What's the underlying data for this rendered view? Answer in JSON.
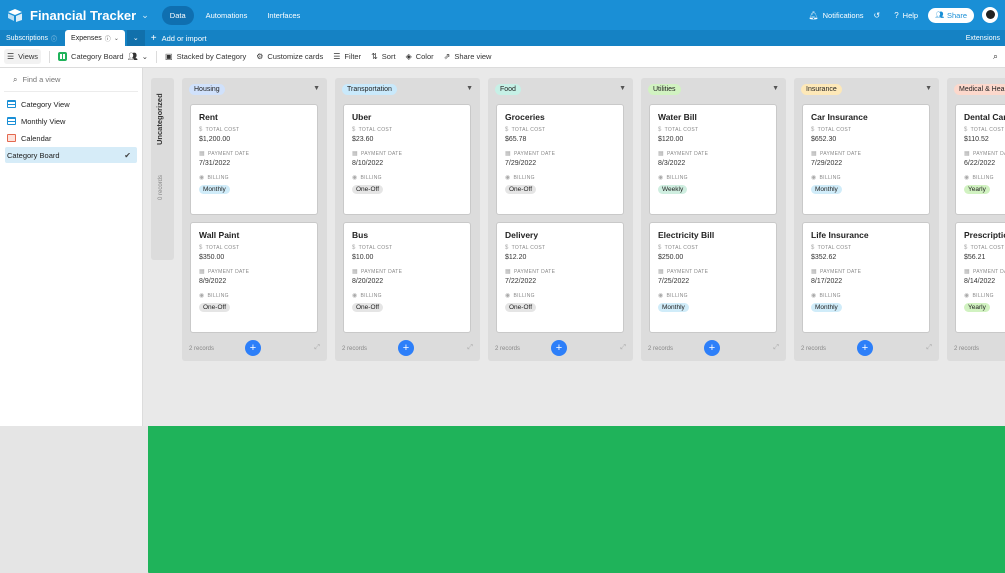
{
  "app": {
    "title": "Financial Tracker",
    "nav": [
      {
        "label": "Data",
        "active": true
      },
      {
        "label": "Automations",
        "active": false
      },
      {
        "label": "Interfaces",
        "active": false
      }
    ],
    "notifications": "Notifications",
    "help": "Help",
    "share": "Share"
  },
  "tabs": {
    "items": [
      {
        "label": "Subscriptions",
        "active": false
      },
      {
        "label": "Expenses",
        "active": true
      }
    ],
    "add_import": "Add or import",
    "extensions": "Extensions"
  },
  "toolbar": {
    "views": "Views",
    "view_name": "Category Board",
    "stacked": "Stacked by Category",
    "customize": "Customize cards",
    "filter": "Filter",
    "sort": "Sort",
    "color": "Color",
    "share_view": "Share view"
  },
  "sidebar": {
    "find_placeholder": "Find a view",
    "views": [
      {
        "label": "Category View",
        "icon": "grid-view-icon",
        "active": false
      },
      {
        "label": "Monthly View",
        "icon": "grid-view-icon",
        "active": false
      },
      {
        "label": "Calendar",
        "icon": "calendar-view-icon",
        "active": false
      },
      {
        "label": "Category Board",
        "icon": "kanban-view-icon",
        "active": true
      }
    ]
  },
  "board": {
    "uncategorized": {
      "label": "Uncategorized",
      "count": "0 records"
    },
    "field_labels": {
      "cost": "TOTAL COST",
      "date": "PAYMENT DATE",
      "billing": "BILLING"
    },
    "columns": [
      {
        "name": "Housing",
        "color": "#d0e1fb",
        "records": "2 records",
        "cards": [
          {
            "title": "Rent",
            "cost": "$1,200.00",
            "date": "7/31/2022",
            "billing": "Monthly"
          },
          {
            "title": "Wall Paint",
            "cost": "$350.00",
            "date": "8/9/2022",
            "billing": "One-Off"
          }
        ]
      },
      {
        "name": "Transportation",
        "color": "#c9e9fb",
        "records": "2 records",
        "cards": [
          {
            "title": "Uber",
            "cost": "$23.60",
            "date": "8/10/2022",
            "billing": "One-Off"
          },
          {
            "title": "Bus",
            "cost": "$10.00",
            "date": "8/20/2022",
            "billing": "One-Off"
          }
        ]
      },
      {
        "name": "Food",
        "color": "#c6f0e6",
        "records": "2 records",
        "cards": [
          {
            "title": "Groceries",
            "cost": "$65.78",
            "date": "7/29/2022",
            "billing": "One-Off"
          },
          {
            "title": "Delivery",
            "cost": "$12.20",
            "date": "7/22/2022",
            "billing": "One-Off"
          }
        ]
      },
      {
        "name": "Utilities",
        "color": "#d1f2c1",
        "records": "2 records",
        "cards": [
          {
            "title": "Water Bill",
            "cost": "$120.00",
            "date": "8/3/2022",
            "billing": "Weekly"
          },
          {
            "title": "Electricity Bill",
            "cost": "$250.00",
            "date": "7/25/2022",
            "billing": "Monthly"
          }
        ]
      },
      {
        "name": "Insurance",
        "color": "#fde8b8",
        "records": "2 records",
        "cards": [
          {
            "title": "Car Insurance",
            "cost": "$652.30",
            "date": "7/29/2022",
            "billing": "Monthly"
          },
          {
            "title": "Life Insurance",
            "cost": "$352.62",
            "date": "8/17/2022",
            "billing": "Monthly"
          }
        ]
      },
      {
        "name": "Medical & Hea",
        "color": "#fcd8cc",
        "records": "2 records",
        "cards": [
          {
            "title": "Dental Care",
            "cost": "$110.52",
            "date": "6/22/2022",
            "billing": "Yearly"
          },
          {
            "title": "Prescriptio",
            "cost": "$56.21",
            "date": "8/14/2022",
            "billing": "Yearly"
          }
        ]
      }
    ]
  }
}
